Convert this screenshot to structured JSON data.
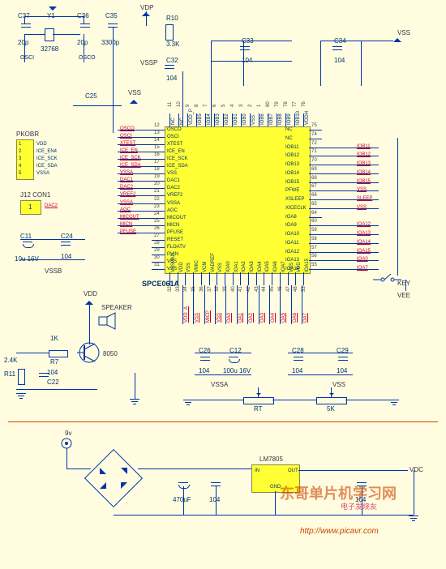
{
  "chip": {
    "name": "SPCE061A",
    "top_pins": [
      "NC",
      "NC",
      "VDD_P",
      "IOB5",
      "IOB4",
      "IOB3",
      "IOB2",
      "IOB1",
      "IOB0",
      "VSS",
      "IOB6",
      "IOB7",
      "IOB8",
      "IOB9",
      "IOB10",
      "VDDH"
    ],
    "top_nums": [
      "11",
      "10",
      "9",
      "8",
      "7",
      "6",
      "5",
      "4",
      "3",
      "2",
      "1",
      "80",
      "79",
      "78",
      "77",
      "76"
    ],
    "left_pins": [
      "OSCO",
      "OSCI",
      "XTEST",
      "ICE_EN",
      "ICE_SCK",
      "ICE_SDA",
      "VSS",
      "DAC1",
      "DAC2",
      "VREF2",
      "VSSA",
      "AGC",
      "MICOUT",
      "MICN",
      "PFUSE",
      "RESET",
      "FLOATV",
      "PVIN",
      "VSS",
      "VSS"
    ],
    "left_nums": [
      "12",
      "13",
      "14",
      "15",
      "16",
      "17",
      "18",
      "19",
      "20",
      "21",
      "22",
      "23",
      "24",
      "25",
      "26",
      "27",
      "28",
      "29",
      "30",
      "31"
    ],
    "right_pins": [
      "NC",
      "NC",
      "IOB11",
      "IOB12",
      "IOB13",
      "IOB14",
      "IOB15",
      "PFWE",
      "XSLEEP",
      "XICECLK",
      "IOA8",
      "IOA9",
      "IOA10",
      "IOA11",
      "IOA12",
      "IOA13",
      "IOA14"
    ],
    "right_nums": [
      "75",
      "74",
      "72",
      "71",
      "70",
      "69",
      "68",
      "67",
      "66",
      "65",
      "64",
      "60",
      "59",
      "58",
      "57",
      "56",
      "55",
      "54"
    ],
    "bottom_pins": [
      "VSSPAD",
      "VDD",
      "VSS",
      "VMIC",
      "VCM",
      "VADREF",
      "VSS",
      "IOA0",
      "IOA1",
      "IOA2",
      "IOA3",
      "IOA4",
      "IOA5",
      "IOA6",
      "IOA7",
      "VSS",
      "VDD",
      "IOA15"
    ],
    "bottom_nums": [
      "32",
      "33",
      "34",
      "35",
      "36",
      "37",
      "38",
      "39",
      "40",
      "41",
      "42",
      "43",
      "44",
      "45",
      "46",
      "47",
      "48",
      "53"
    ]
  },
  "nets_left": [
    "OSCO",
    "OSCI",
    "XTEST",
    "ICE_EN",
    "ICE_SCK",
    "ICE_SDA",
    "VSSA",
    "DAC1",
    "DAC2",
    "VREF2",
    "VSSA",
    "AGC",
    "MICOUT",
    "MICN",
    "PFUSE"
  ],
  "nets_right_upper": [
    "IOB11",
    "IOB12",
    "IOB13",
    "IOB14",
    "IOB15",
    "VSS",
    "SLEEP",
    "VSS"
  ],
  "nets_right_lower": [
    "IOA12",
    "IOA13",
    "IOA14",
    "IOA15",
    "IOA0",
    "IOA7"
  ],
  "nets_bottom": [
    "VDD_A",
    "VSS",
    "MICP",
    "VSS",
    "OA0",
    "OA1",
    "OA2",
    "OA3",
    "OA4",
    "OA5",
    "OA6",
    "OA7"
  ],
  "components": {
    "C37": {
      "ref": "C37",
      "val": "20p"
    },
    "C36": {
      "ref": "C36",
      "val": "20p"
    },
    "C35": {
      "ref": "C35",
      "val": "3300p"
    },
    "Y1": {
      "ref": "Y1",
      "val": "32768"
    },
    "R10": {
      "ref": "R10",
      "val": "3.3K"
    },
    "C32": {
      "ref": "C32",
      "val": "104"
    },
    "C33": {
      "ref": "C33",
      "val": "104"
    },
    "C34": {
      "ref": "C34",
      "val": "104"
    },
    "C25": {
      "ref": "C25",
      "val": ""
    },
    "C11": {
      "ref": "C11",
      "val": "10u 16V"
    },
    "C24": {
      "ref": "C24",
      "val": "104"
    },
    "R7": {
      "ref": "R7",
      "val": "1K"
    },
    "R11": {
      "ref": "R11",
      "val": "2.4K"
    },
    "C22": {
      "ref": "C22",
      "val": "104"
    },
    "C26": {
      "ref": "C26",
      "val": "104"
    },
    "C12": {
      "ref": "C12",
      "val": "100u 16V"
    },
    "C28": {
      "ref": "C28",
      "val": "104"
    },
    "C29": {
      "ref": "C29",
      "val": "104"
    },
    "Q1": {
      "ref": "8050",
      "val": ""
    },
    "U1": {
      "ref": "LM7805",
      "pins": [
        "IN",
        "GND",
        "OUT"
      ]
    },
    "C_in": {
      "ref": "",
      "val": "470uF"
    },
    "C_in2": {
      "ref": "",
      "val": "104"
    },
    "C_out": {
      "ref": "",
      "val": "104"
    },
    "RT": {
      "ref": "RT",
      "val": ""
    },
    "R5K": {
      "ref": "",
      "val": "5K"
    }
  },
  "power": {
    "VDP": "VDP",
    "VSSP": "VSSP",
    "VSS": "VSS",
    "VDD": "VDD",
    "VSSA": "VSSA",
    "VSSB": "VSSB",
    "VEE": "VEE",
    "VDC": "VDC",
    "9v": "9v"
  },
  "connectors": {
    "PKOBR": {
      "name": "PKOBR",
      "pins": [
        "VDD",
        "ICE_EN4",
        "ICE_SCK",
        "ICE_SDA",
        "VSSA"
      ],
      "nums": [
        "1",
        "2",
        "3",
        "4",
        "5"
      ]
    },
    "J12": {
      "name": "J12 CON1",
      "pin": "1",
      "net": "DAC2"
    },
    "VDD_SPK": {
      "name": "SPEAKER",
      "net": "VDD"
    },
    "KEY": {
      "name": "KEY"
    }
  },
  "osc_labels": {
    "OSCI": "OSCI",
    "OSCO": "OSCO"
  },
  "watermark": "东哥单片机学习网",
  "watermark2": "电子发烧友",
  "url": "http://www.picavr.com"
}
